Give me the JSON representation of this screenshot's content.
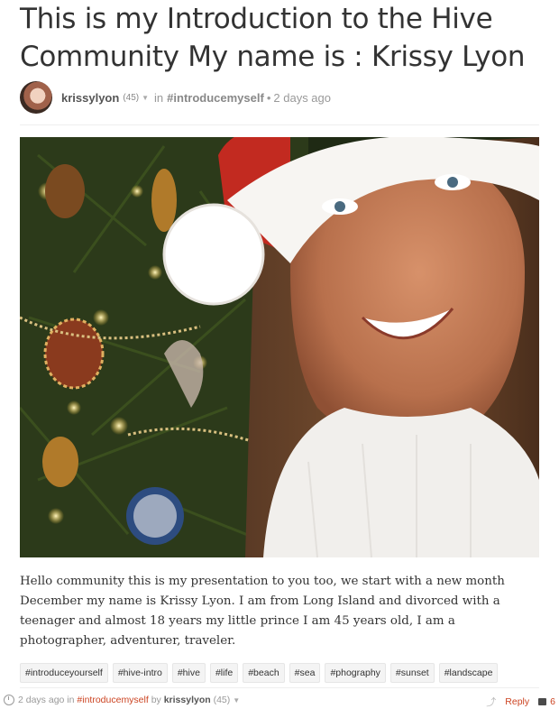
{
  "post": {
    "title": "This is my Introduction to the Hive Community My name is : Krissy Lyon",
    "author": "krissylyon",
    "reputation": "(45)",
    "in_label": "in",
    "category": "#introducemyself",
    "age": "2 days ago",
    "body": "Hello community this is my presentation to you too, we start with a new month December my name is Krissy Lyon. I am from Long Island and divorced with a teenager and almost 18 years my little prince I am 45 years old, I am a photographer, adventurer, traveler."
  },
  "tags": [
    "#introduceyourself",
    "#hive-intro",
    "#hive",
    "#life",
    "#beach",
    "#sea",
    "#phography",
    "#sunset",
    "#landscape"
  ],
  "footer": {
    "age": "2 days ago",
    "in_label": "in",
    "category": "#introducemyself",
    "by_label": "by",
    "author": "krissylyon",
    "reputation": "(45)",
    "reply_label": "Reply",
    "comment_count": "6"
  },
  "colors": {
    "link": "#cc4422",
    "title": "#333333",
    "muted": "#999999"
  },
  "icons": [
    "avatar",
    "caret-down-icon",
    "clock-icon",
    "share-icon",
    "comment-icon"
  ]
}
